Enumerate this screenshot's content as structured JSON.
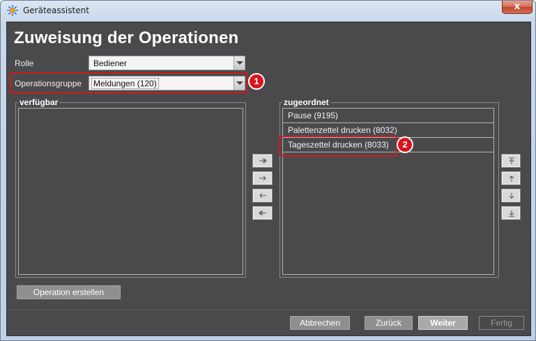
{
  "window": {
    "title": "Geräteassistent",
    "close_symbol": "x"
  },
  "page": {
    "title": "Zuweisung der Operationen"
  },
  "form": {
    "rolle": {
      "label": "Rolle",
      "value": "Bediener"
    },
    "operationsgruppe": {
      "label": "Operationsgruppe",
      "value": "Meldungen (120)"
    }
  },
  "callouts": [
    "1",
    "2"
  ],
  "available": {
    "title": "verfügbar",
    "items": []
  },
  "assigned": {
    "title": "zugeordnet",
    "items": [
      "Pause (9195)",
      "Palettenzettel drucken (8032)",
      "Tageszettel drucken (8033)"
    ]
  },
  "transfer_buttons": [
    "move-all-right-icon",
    "move-right-icon",
    "move-left-icon",
    "move-all-left-icon"
  ],
  "order_buttons": [
    "move-to-top-icon",
    "move-up-icon",
    "move-down-icon",
    "move-to-bottom-icon"
  ],
  "actions": {
    "create_operation": "Operation erstellen",
    "cancel": "Abbrechen",
    "back": "Zurück",
    "next": "Weiter",
    "finish": "Fertig"
  },
  "colors": {
    "highlight": "#d11a1a",
    "dialog_bg": "#4a4a4d"
  }
}
